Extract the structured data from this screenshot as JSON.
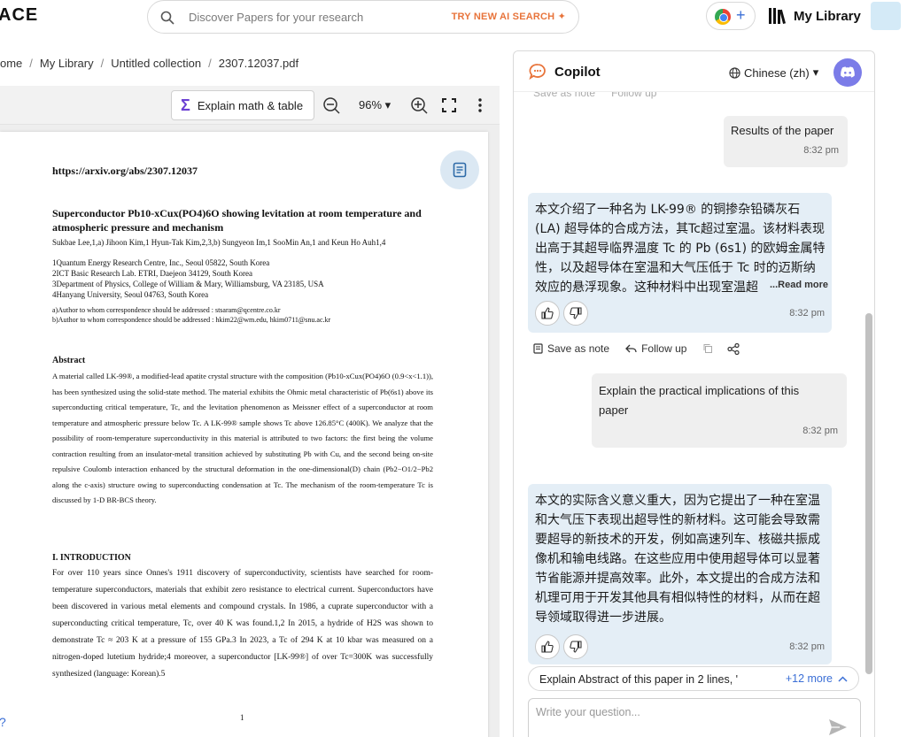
{
  "topbar": {
    "logo": "ACE",
    "search_placeholder": "Discover Papers for your research",
    "ai_search_label": "TRY NEW AI SEARCH",
    "my_library_label": "My Library"
  },
  "breadcrumb": [
    "ome",
    "My Library",
    "Untitled collection",
    "2307.12037.pdf"
  ],
  "pdf_toolbar": {
    "explain_label": "Explain math & table",
    "zoom": "96%"
  },
  "page": {
    "url": "https://arxiv.org/abs/2307.12037",
    "title_line1": "Superconductor Pb10-xCux(PO4)6O showing levitation at room temperature and",
    "title_line2": "atmospheric pressure and mechanism",
    "authors": "Sukbae Lee,1,a) Jihoon Kim,1 Hyun-Tak Kim,2,3,b) Sungyeon Im,1 SooMin An,1 and Keun Ho Auh1,4",
    "affiliations": [
      "1Quantum Energy Research Centre, Inc., Seoul 05822, South Korea",
      "2ICT Basic Research Lab. ETRI, Daejeon 34129, South Korea",
      "3Department of Physics, College of William & Mary, Williamsburg, VA 23185, USA",
      "4Hanyang University, Seoul 04763, South Korea"
    ],
    "correspondence": [
      "a)Author to whom correspondence should be addressed : stsaram@qcentre.co.kr",
      "b)Author to whom correspondence should be addressed : hkim22@wm.edu, hkim0711@snu.ac.kr"
    ],
    "abstract_heading": "Abstract",
    "abstract_text": "A material called LK-99®, a modified-lead apatite crystal structure with the composition (Pb10-xCux(PO4)6O (0.9<x<1.1)), has been synthesized using the solid-state method. The material exhibits the Ohmic metal characteristic of Pb(6s1) above its superconducting critical temperature, Tc, and the levitation phenomenon as Meissner effect of a superconductor at room temperature and atmospheric pressure below Tc. A LK-99® sample shows Tc above 126.85°C (400K). We analyze that the possibility of room-temperature superconductivity in this material is attributed to two factors: the first being the volume contraction resulting from an insulator-metal transition achieved by substituting Pb with Cu, and the second being on-site repulsive Coulomb interaction enhanced by the structural deformation in the one-dimensional(D) chain (Pb2−O1/2−Pb2 along the c-axis) structure owing to superconducting condensation at Tc. The mechanism of the room-temperature Tc is discussed by 1-D BR-BCS theory.",
    "intro_heading": "I. INTRODUCTION",
    "intro_text": "For over 110 years since Onnes's 1911 discovery of superconductivity, scientists have searched for room-temperature superconductors, materials that exhibit zero resistance to electrical current. Superconductors have been discovered in various metal elements and compound crystals. In 1986, a cuprate superconductor with a superconducting critical temperature, Tc, over 40 K was found.1,2 In 2015, a hydride of H2S was shown to demonstrate Tc ≈ 203 K at a pressure of 155 GPa.3 In 2023, a Tc of 294 K at 10 kbar was measured on a nitrogen-doped lutetium hydride;4 moreover, a superconductor [LK-99®] of over Tc=300K was successfully synthesized (language: Korean).5",
    "page_number": "1"
  },
  "help_label": "?",
  "copilot": {
    "title": "Copilot",
    "language": "Chinese (zh)",
    "ghost_actions": [
      "Save as note",
      "Follow up"
    ],
    "messages": [
      {
        "role": "user",
        "text": "Results of the paper",
        "time": "8:32 pm"
      },
      {
        "role": "bot",
        "text": "本文介绍了一种名为 LK-99® 的铜掺杂铅磷灰石 (LA) 超导体的合成方法，其Tc超过室温。该材料表现出高于其超导临界温度 Tc 的 Pb (6s1) 的欧姆金属特性，以及超导体在室温和大气压低于 Tc 时的迈斯纳效应的悬浮现象。这种材料中出现室温超",
        "more": "...Read more",
        "time": "8:32 pm"
      },
      {
        "role": "user",
        "text": "Explain the practical implications of this paper",
        "time": "8:32 pm"
      },
      {
        "role": "bot",
        "text": "本文的实际含义意义重大，因为它提出了一种在室温和大气压下表现出超导性的新材料。这可能会导致需要超导的新技术的开发，例如高速列车、核磁共振成像机和输电线路。在这些应用中使用超导体可以显著节省能源并提高效率。此外，本文提出的合成方法和机理可用于开发其他具有相似特性的材料，从而在超导领域取得进一步进展。",
        "time": "8:32 pm"
      }
    ],
    "actions": {
      "save": "Save as note",
      "follow": "Follow up"
    },
    "suggestion": "Explain Abstract of this paper in 2 lines, '",
    "suggestion_more": "+12 more",
    "input_placeholder": "Write your question..."
  },
  "colors": {
    "accent_blue": "#3b6fd6",
    "bot_bubble": "#e4eef6",
    "user_bubble": "#efefef",
    "ai_orange": "#e8743b",
    "sigma_purple": "#6b3fd3"
  }
}
